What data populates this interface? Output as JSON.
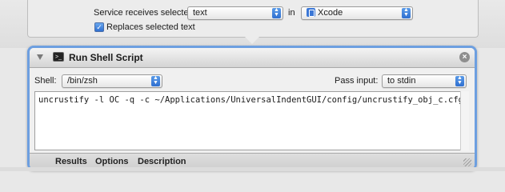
{
  "service": {
    "label": "Service receives selected",
    "type_value": "text",
    "in_label": "in",
    "app_value": "Xcode",
    "app_icon": "xcode-icon",
    "replaces_checked": true,
    "replaces_label": "Replaces selected text"
  },
  "action": {
    "title": "Run Shell Script",
    "icon": "terminal-icon",
    "shell_label": "Shell:",
    "shell_value": "/bin/zsh",
    "pass_input_label": "Pass input:",
    "pass_input_value": "to stdin",
    "script": "uncrustify -l OC -q -c ~/Applications/UniversalIndentGUI/config/uncrustify_obj_c.cfg",
    "footer_tabs": [
      "Results",
      "Options",
      "Description"
    ]
  },
  "colors": {
    "accent_blue": "#6d9fe0",
    "popup_arrow_blue": "#2f6fd0"
  }
}
